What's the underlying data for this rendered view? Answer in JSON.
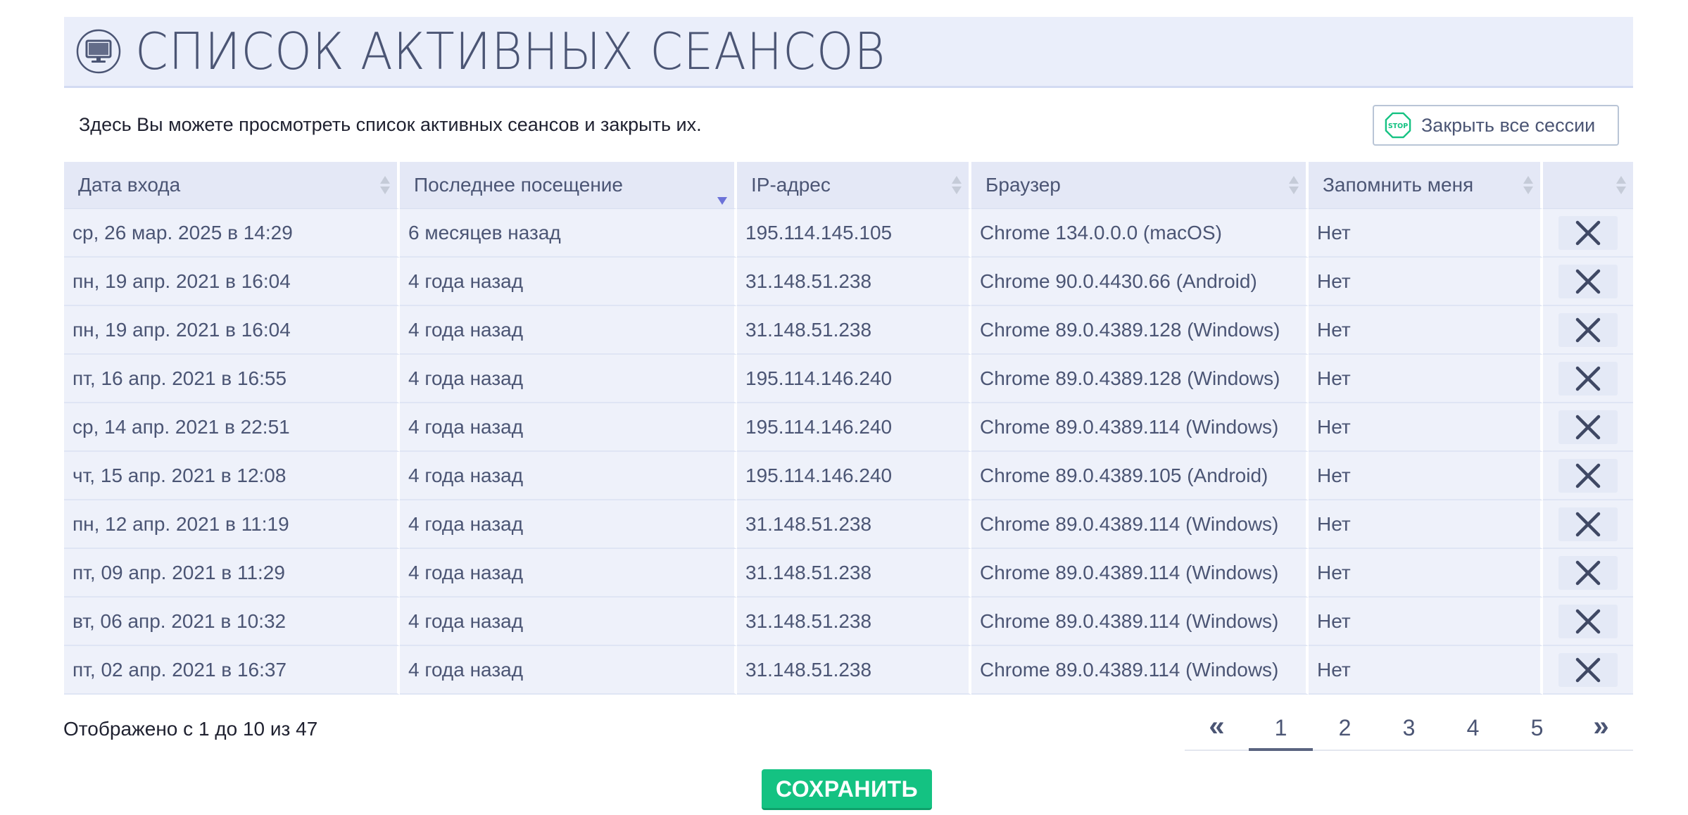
{
  "header": {
    "title": "СПИСОК АКТИВНЫХ СЕАНСОВ",
    "icon": "monitor-icon"
  },
  "intro": {
    "text": "Здесь Вы можете просмотреть список активных сеансов и закрыть их.",
    "close_all_label": "Закрыть все сессии",
    "close_all_icon_text": "STOP"
  },
  "table": {
    "columns": [
      "Дата входа",
      "Последнее посещение",
      "IP-адрес",
      "Браузер",
      "Запомнить меня",
      ""
    ],
    "rows": [
      {
        "date": "ср, 26 мар. 2025 в 14:29",
        "last": "6 месяцев назад",
        "ip": "195.114.145.105",
        "browser": "Chrome 134.0.0.0 (macOS)",
        "remember": "Нет"
      },
      {
        "date": "пн, 19 апр. 2021 в 16:04",
        "last": "4 года назад",
        "ip": "31.148.51.238",
        "browser": "Chrome 90.0.4430.66 (Android)",
        "remember": "Нет"
      },
      {
        "date": "пн, 19 апр. 2021 в 16:04",
        "last": "4 года назад",
        "ip": "31.148.51.238",
        "browser": "Chrome 89.0.4389.128 (Windows)",
        "remember": "Нет"
      },
      {
        "date": "пт, 16 апр. 2021 в 16:55",
        "last": "4 года назад",
        "ip": "195.114.146.240",
        "browser": "Chrome 89.0.4389.128 (Windows)",
        "remember": "Нет"
      },
      {
        "date": "ср, 14 апр. 2021 в 22:51",
        "last": "4 года назад",
        "ip": "195.114.146.240",
        "browser": "Chrome 89.0.4389.114 (Windows)",
        "remember": "Нет"
      },
      {
        "date": "чт, 15 апр. 2021 в 12:08",
        "last": "4 года назад",
        "ip": "195.114.146.240",
        "browser": "Chrome 89.0.4389.105 (Android)",
        "remember": "Нет"
      },
      {
        "date": "пн, 12 апр. 2021 в 11:19",
        "last": "4 года назад",
        "ip": "31.148.51.238",
        "browser": "Chrome 89.0.4389.114 (Windows)",
        "remember": "Нет"
      },
      {
        "date": "пт, 09 апр. 2021 в 11:29",
        "last": "4 года назад",
        "ip": "31.148.51.238",
        "browser": "Chrome 89.0.4389.114 (Windows)",
        "remember": "Нет"
      },
      {
        "date": "вт, 06 апр. 2021 в 10:32",
        "last": "4 года назад",
        "ip": "31.148.51.238",
        "browser": "Chrome 89.0.4389.114 (Windows)",
        "remember": "Нет"
      },
      {
        "date": "пт, 02 апр. 2021 в 16:37",
        "last": "4 года назад",
        "ip": "31.148.51.238",
        "browser": "Chrome 89.0.4389.114 (Windows)",
        "remember": "Нет"
      }
    ]
  },
  "footer": {
    "info": "Отображено с 1 до 10 из 47",
    "pagination": {
      "prev": "«",
      "pages": [
        "1",
        "2",
        "3",
        "4",
        "5"
      ],
      "next": "»",
      "active": "1"
    }
  },
  "save_label": "СОХРАНИТЬ",
  "colors": {
    "accent": "#14c282",
    "header_bg": "#eaeefa",
    "row_bg": "#eef1fa",
    "sort_active": "#6c72d8"
  }
}
